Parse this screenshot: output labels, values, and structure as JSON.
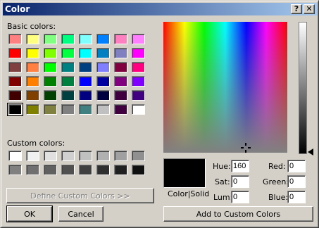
{
  "window": {
    "title": "Color",
    "help_label": "?",
    "close_label": "✕"
  },
  "basic_colors": {
    "label": "Basic colors:",
    "swatches": [
      "#ff8080",
      "#ffff80",
      "#80ff80",
      "#00ff80",
      "#80ffff",
      "#0080ff",
      "#ff80c0",
      "#ff80ff",
      "#ff0000",
      "#ffff00",
      "#80ff00",
      "#00ff40",
      "#00ffff",
      "#0080c0",
      "#8080c0",
      "#ff00ff",
      "#804040",
      "#ff8040",
      "#00ff00",
      "#008080",
      "#004080",
      "#8080ff",
      "#800040",
      "#ff0080",
      "#800000",
      "#ff8000",
      "#008000",
      "#008040",
      "#0000ff",
      "#0000a0",
      "#800080",
      "#8000ff",
      "#400000",
      "#804000",
      "#004000",
      "#004040",
      "#000080",
      "#000040",
      "#400040",
      "#400080",
      "#000000",
      "#808000",
      "#808040",
      "#808080",
      "#408080",
      "#c0c0c0",
      "#400040",
      "#ffffff"
    ],
    "selected_index": 40
  },
  "custom_colors": {
    "label": "Custom colors:",
    "swatches": [
      "#ffffff",
      "#f0f0f0",
      "#e0e0e0",
      "#d0d0d0",
      "#c0c0c0",
      "#b0b0b0",
      "#a0a0a0",
      "#909090",
      "#808080",
      "#707070",
      "#606060",
      "#505050",
      "#404040",
      "#303030",
      "#202020",
      "#101010"
    ]
  },
  "buttons": {
    "define_custom": "Define Custom Colors >>",
    "ok": "OK",
    "cancel": "Cancel",
    "add_custom": "Add to Custom Colors"
  },
  "preview": {
    "label": "Color|Solid",
    "color": "#000000"
  },
  "fields": {
    "hue": {
      "label": "Hue:",
      "value": "160"
    },
    "sat": {
      "label": "Sat:",
      "value": "0"
    },
    "lum": {
      "label": "Lum:",
      "value": "0"
    },
    "red": {
      "label": "Red:",
      "value": "0"
    },
    "green": {
      "label": "Green:",
      "value": "0"
    },
    "blue": {
      "label": "Blue:",
      "value": "0"
    }
  }
}
